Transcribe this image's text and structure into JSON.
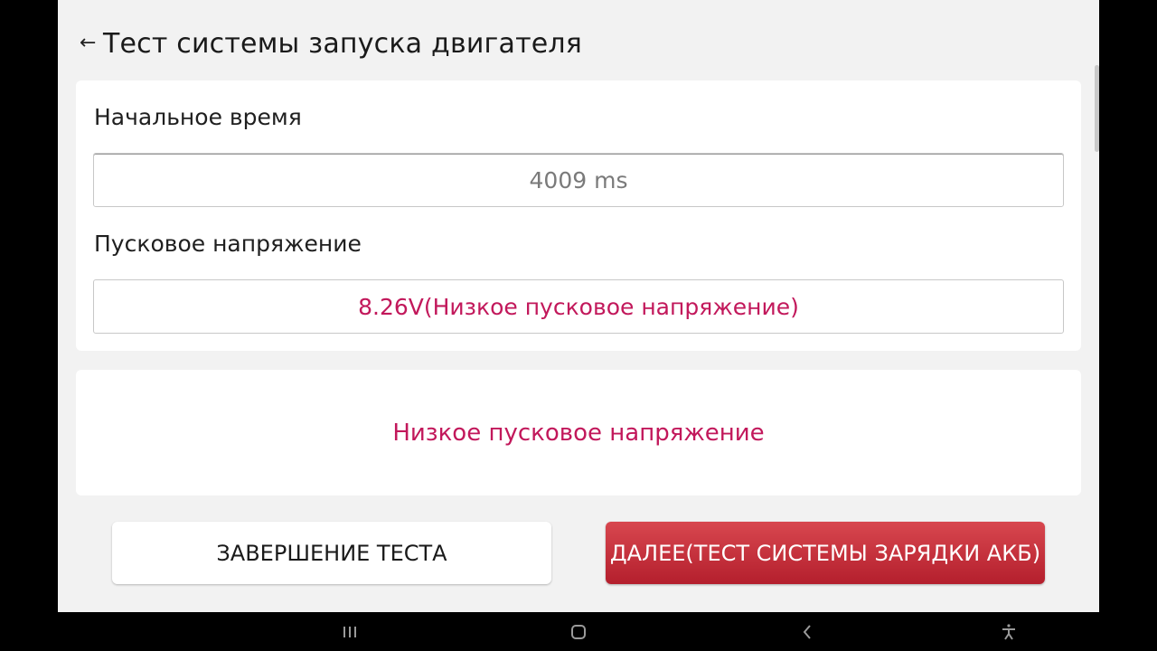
{
  "header": {
    "back_icon": "arrow-left-icon",
    "title": "Тест системы запуска двигателя"
  },
  "readings": {
    "start_time_label": "Начальное время",
    "start_time_value": "4009 ms",
    "voltage_label": "Пусковое напряжение",
    "voltage_value": "8.26V(Низкое пусковое напряжение)"
  },
  "message": {
    "text": "Низкое пусковое напряжение"
  },
  "buttons": {
    "finish_label": "ЗАВЕРШЕНИЕ ТЕСТА",
    "next_label": "ДАЛЕЕ(ТЕСТ СИСТЕМЫ ЗАРЯДКИ АКБ)"
  },
  "navbar": {
    "recent_icon": "recent-apps-icon",
    "home_icon": "home-icon",
    "back_icon": "back-icon",
    "accessibility_icon": "accessibility-icon"
  },
  "colors": {
    "accent_text": "#c2185b",
    "primary_button": "#c62832",
    "background": "#f2f2f2"
  }
}
